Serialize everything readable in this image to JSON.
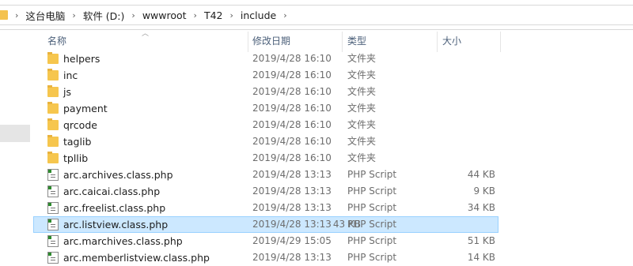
{
  "breadcrumb": [
    {
      "label": "这台电脑"
    },
    {
      "label": "软件 (D:)"
    },
    {
      "label": "wwwroot"
    },
    {
      "label": "T42"
    },
    {
      "label": "include"
    }
  ],
  "columns": {
    "name": "名称",
    "date": "修改日期",
    "type": "类型",
    "size": "大小"
  },
  "files": [
    {
      "name": "helpers",
      "date": "2019/4/28 16:10",
      "type": "文件夹",
      "size": "",
      "icon": "folder-icon"
    },
    {
      "name": "inc",
      "date": "2019/4/28 16:10",
      "type": "文件夹",
      "size": "",
      "icon": "folder-icon"
    },
    {
      "name": "js",
      "date": "2019/4/28 16:10",
      "type": "文件夹",
      "size": "",
      "icon": "folder-icon"
    },
    {
      "name": "payment",
      "date": "2019/4/28 16:10",
      "type": "文件夹",
      "size": "",
      "icon": "folder-icon"
    },
    {
      "name": "qrcode",
      "date": "2019/4/28 16:10",
      "type": "文件夹",
      "size": "",
      "icon": "folder-icon"
    },
    {
      "name": "taglib",
      "date": "2019/4/28 16:10",
      "type": "文件夹",
      "size": "",
      "icon": "folder-icon"
    },
    {
      "name": "tpllib",
      "date": "2019/4/28 16:10",
      "type": "文件夹",
      "size": "",
      "icon": "folder-icon"
    },
    {
      "name": "arc.archives.class.php",
      "date": "2019/4/28 13:13",
      "type": "PHP Script",
      "size": "44 KB",
      "icon": "php-file-icon"
    },
    {
      "name": "arc.caicai.class.php",
      "date": "2019/4/28 13:13",
      "type": "PHP Script",
      "size": "9 KB",
      "icon": "php-file-icon"
    },
    {
      "name": "arc.freelist.class.php",
      "date": "2019/4/28 13:13",
      "type": "PHP Script",
      "size": "34 KB",
      "icon": "php-file-icon"
    },
    {
      "name": "arc.listview.class.php",
      "date": "2019/4/28 13:13",
      "type": "PHP Script",
      "size": "43 KB",
      "icon": "php-file-icon",
      "selected": true
    },
    {
      "name": "arc.marchives.class.php",
      "date": "2019/4/29 15:05",
      "type": "PHP Script",
      "size": "51 KB",
      "icon": "php-file-icon"
    },
    {
      "name": "arc.memberlistview.class.php",
      "date": "2019/4/28 13:13",
      "type": "PHP Script",
      "size": "14 KB",
      "icon": "php-file-icon"
    }
  ],
  "colors": {
    "selection": "#cce8ff",
    "header_text": "#4c607a",
    "folder": "#f6c64e"
  }
}
